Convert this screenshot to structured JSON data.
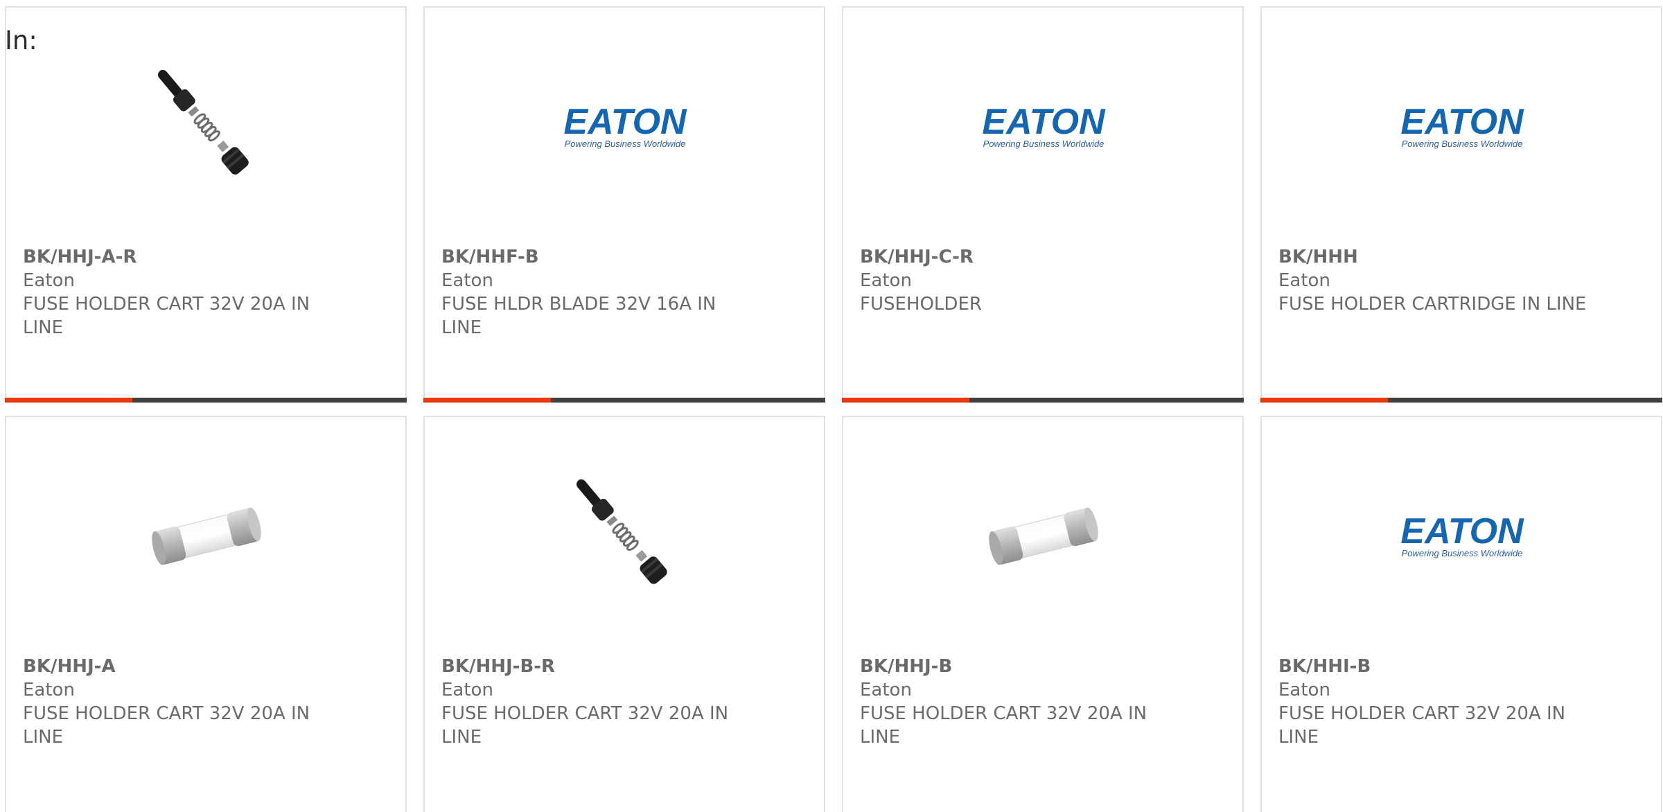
{
  "header": {
    "label": "In:"
  },
  "colors": {
    "accent": "#e8380d",
    "bar": "#404040",
    "eaton_blue": "#1466b0"
  },
  "products": [
    {
      "part": "BK/HHJ-A-R",
      "brand": "Eaton",
      "desc": "FUSE HOLDER CART 32V 20A IN LINE",
      "image": "inline-fuse-holder-icon"
    },
    {
      "part": "BK/HHF-B",
      "brand": "Eaton",
      "desc": "FUSE HLDR BLADE 32V 16A IN LINE",
      "image": "eaton-logo-icon"
    },
    {
      "part": "BK/HHJ-C-R",
      "brand": "Eaton",
      "desc": "FUSEHOLDER",
      "image": "eaton-logo-icon"
    },
    {
      "part": "BK/HHH",
      "brand": "Eaton",
      "desc": "FUSE HOLDER CARTRIDGE IN LINE",
      "image": "eaton-logo-icon"
    },
    {
      "part": "BK/HHJ-A",
      "brand": "Eaton",
      "desc": "FUSE HOLDER CART 32V 20A IN LINE",
      "image": "cartridge-fuse-icon"
    },
    {
      "part": "BK/HHJ-B-R",
      "brand": "Eaton",
      "desc": "FUSE HOLDER CART 32V 20A IN LINE",
      "image": "inline-fuse-holder-icon"
    },
    {
      "part": "BK/HHJ-B",
      "brand": "Eaton",
      "desc": "FUSE HOLDER CART 32V 20A IN LINE",
      "image": "cartridge-fuse-icon"
    },
    {
      "part": "BK/HHI-B",
      "brand": "Eaton",
      "desc": "FUSE HOLDER CART 32V 20A IN LINE",
      "image": "eaton-logo-icon"
    }
  ],
  "logo": {
    "wordmark": "EATON",
    "tagline": "Powering Business Worldwide"
  }
}
